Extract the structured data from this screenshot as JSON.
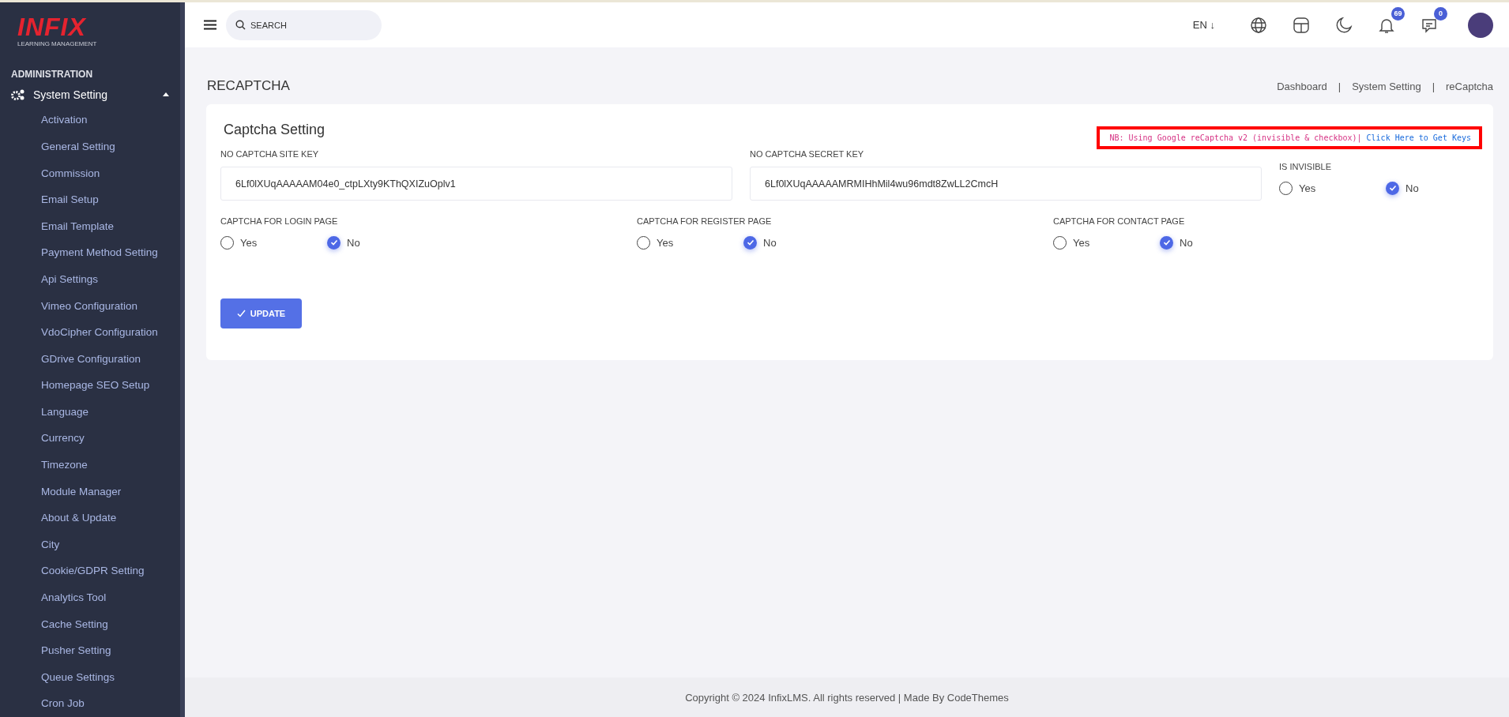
{
  "sidebar": {
    "logo": {
      "brand": "INFIX",
      "tagline": "LEARNING MANAGEMENT"
    },
    "section": "ADMINISTRATION",
    "group": {
      "label": "System Setting",
      "expanded": true
    },
    "items": [
      "Activation",
      "General Setting",
      "Commission",
      "Email Setup",
      "Email Template",
      "Payment Method Setting",
      "Api Settings",
      "Vimeo Configuration",
      "VdoCipher Configuration",
      "GDrive Configuration",
      "Homepage SEO Setup",
      "Language",
      "Currency",
      "Timezone",
      "Module Manager",
      "About & Update",
      "City",
      "Cookie/GDPR Setting",
      "Analytics Tool",
      "Cache Setting",
      "Pusher Setting",
      "Queue Settings",
      "Cron Job"
    ]
  },
  "header": {
    "search": {
      "placeholder": "SEARCH"
    },
    "language": "EN",
    "language_arrow": "↓",
    "notifications": "69",
    "messages": "0"
  },
  "page": {
    "title": "RECAPTCHA",
    "breadcrumb": [
      "Dashboard",
      "System Setting",
      "reCaptcha"
    ],
    "separator": "|"
  },
  "card": {
    "title": "Captcha Setting",
    "note": {
      "text": "NB: Using Google reCaptcha v2 (invisible & checkbox)|",
      "link": "Click Here to Get Keys"
    },
    "fields": [
      {
        "label": "NO CAPTCHA SITE KEY",
        "value": "6Lf0lXUqAAAAAM04e0_ctpLXty9KThQXIZuOplv1"
      },
      {
        "label": "NO CAPTCHA SECRET KEY",
        "value": "6Lf0lXUqAAAAAMRMIHhMil4wu96mdt8ZwLL2CmcH"
      }
    ],
    "invisible": {
      "label": "IS INVISIBLE",
      "options": [
        {
          "label": "Yes",
          "selected": false
        },
        {
          "label": "No",
          "selected": true
        }
      ]
    },
    "groups": [
      {
        "label": "CAPTCHA FOR LOGIN PAGE",
        "options": [
          {
            "label": "Yes",
            "selected": false
          },
          {
            "label": "No",
            "selected": true
          }
        ]
      },
      {
        "label": "CAPTCHA FOR REGISTER PAGE",
        "options": [
          {
            "label": "Yes",
            "selected": false
          },
          {
            "label": "No",
            "selected": true
          }
        ]
      },
      {
        "label": "CAPTCHA FOR CONTACT PAGE",
        "options": [
          {
            "label": "Yes",
            "selected": false
          },
          {
            "label": "No",
            "selected": true
          }
        ]
      }
    ],
    "button": "UPDATE"
  },
  "footer": "Copyright © 2024 InfixLMS. All rights reserved | Made By CodeThemes"
}
